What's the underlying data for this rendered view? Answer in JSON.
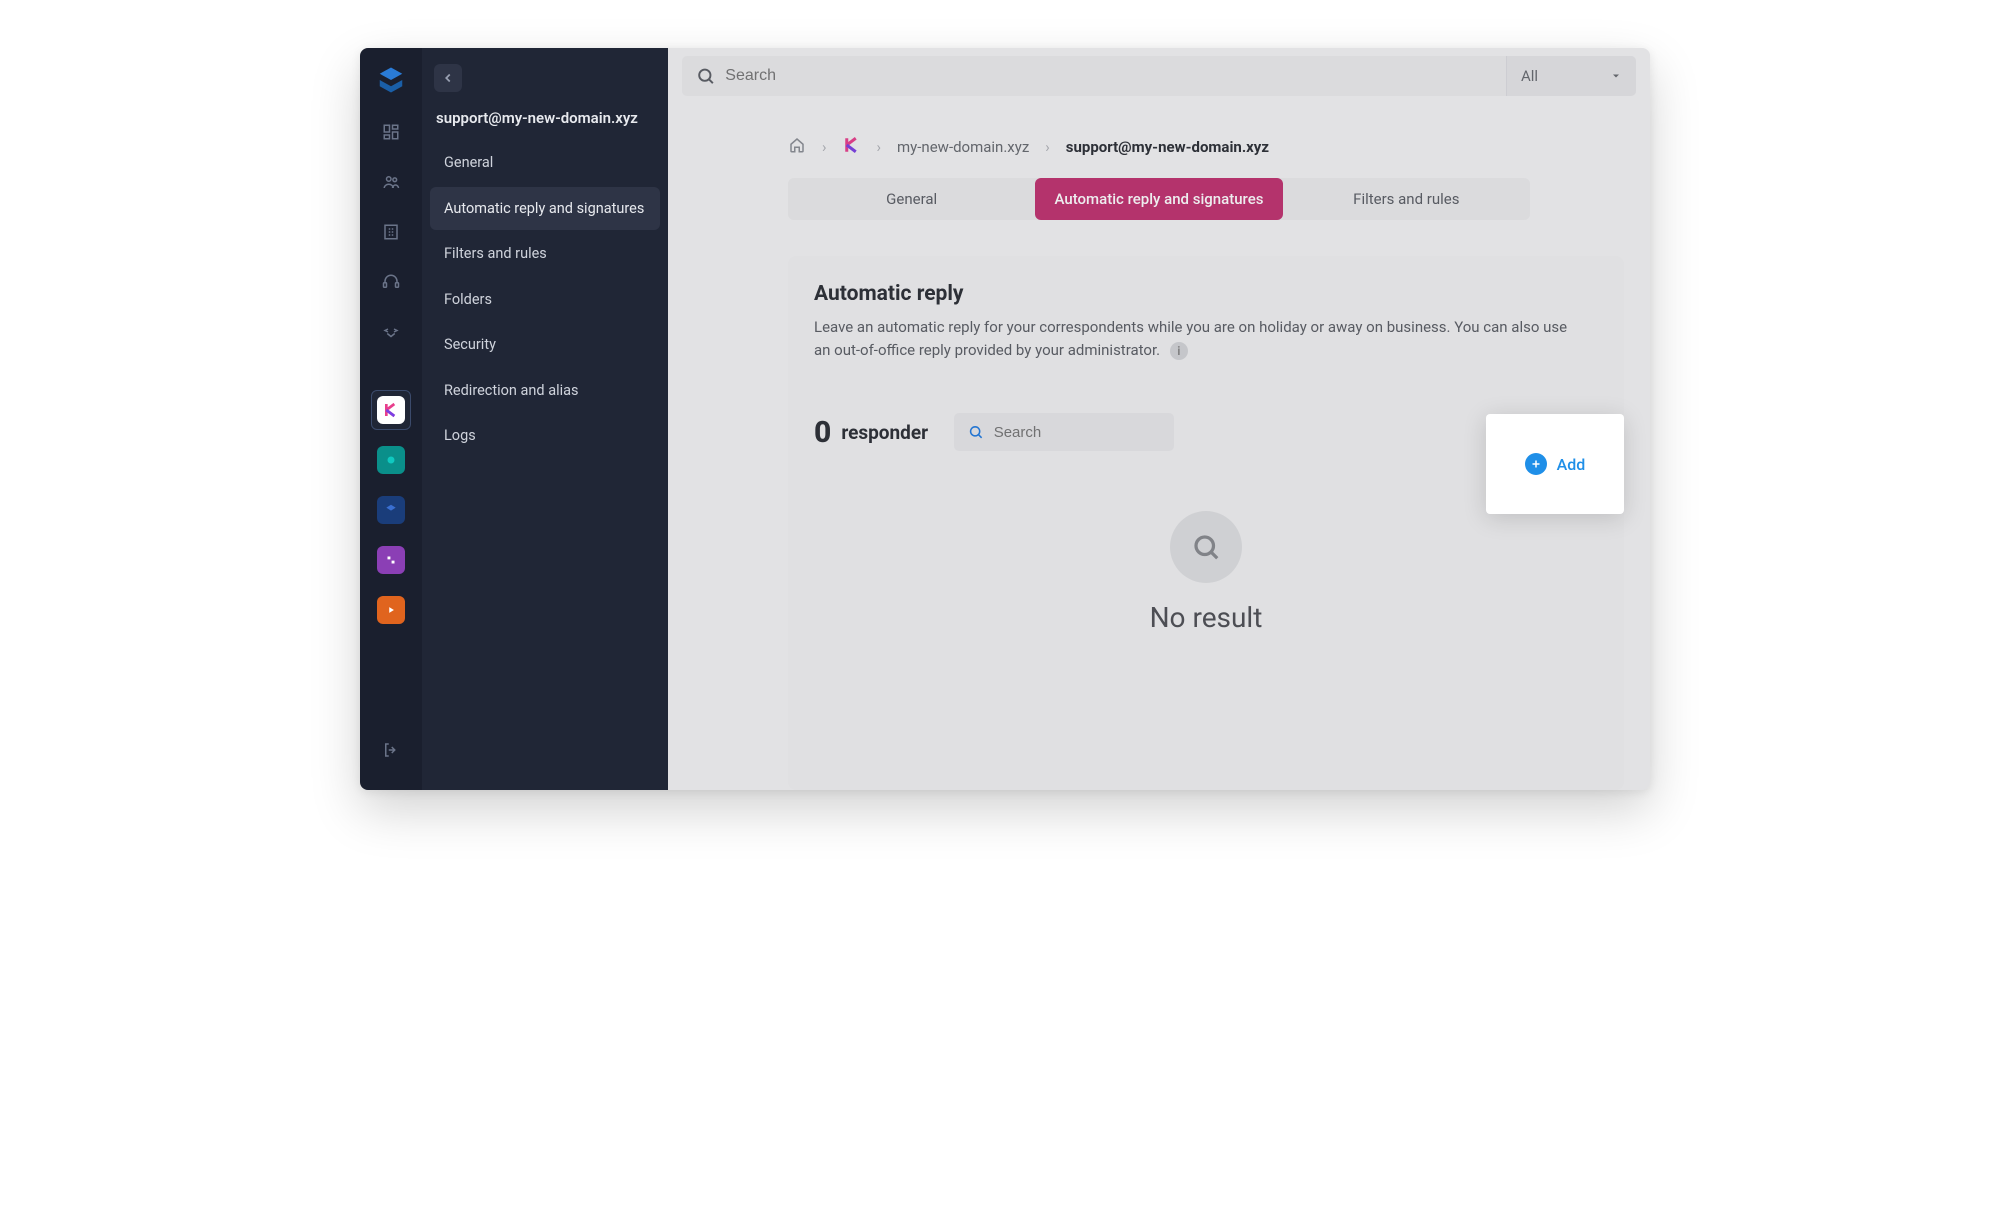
{
  "sidebar": {
    "account": "support@my-new-domain.xyz",
    "items": [
      "General",
      "Automatic reply and signatures",
      "Filters and rules",
      "Folders",
      "Security",
      "Redirection and alias",
      "Logs"
    ],
    "active_index": 1
  },
  "topbar": {
    "search_placeholder": "Search",
    "filter_label": "All"
  },
  "breadcrumb": {
    "domain": "my-new-domain.xyz",
    "current": "support@my-new-domain.xyz"
  },
  "tabs": {
    "items": [
      "General",
      "Automatic reply and signatures",
      "Filters and rules"
    ],
    "active_index": 1
  },
  "panel": {
    "title": "Automatic reply",
    "description": "Leave an automatic reply for your correspondents while you are on holiday or away on business. You can also use an out-of-office reply provided by your administrator.",
    "count": "0",
    "count_label": "responder",
    "mini_search_placeholder": "Search",
    "add_label": "Add",
    "empty_message": "No result"
  }
}
